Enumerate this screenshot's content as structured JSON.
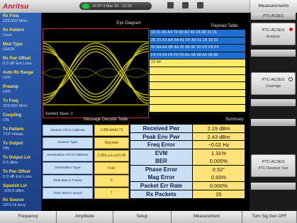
{
  "header": {
    "brand": "Anritsu",
    "status_text": "16:57 4 Mar 15 · 12:23",
    "measurements_tab": "Measurements"
  },
  "left_panel": [
    {
      "label": "Rx Freq",
      "value": "229.650 MHz"
    },
    {
      "label": "Rx Pattern",
      "value": "Cont"
    },
    {
      "label": "Mod Type",
      "value": "GMSK"
    },
    {
      "label": "Rx Pwr Offset",
      "value": "0.0 dB Ext Loss"
    },
    {
      "label": "Auto Rx Range",
      "value": "OFF"
    },
    {
      "label": "Preamp",
      "value": "OFF"
    },
    {
      "label": "Tx Freq",
      "value": "229.650 MHz"
    },
    {
      "label": "Coupling",
      "value": "ON"
    },
    {
      "label": "Tx Pattern",
      "value": "TCP Hdata"
    },
    {
      "label": "Tx Output",
      "value": "ON"
    },
    {
      "label": "Tx Output Lvl",
      "value": "0.5 dBm"
    },
    {
      "label": "Tx Pwr Offset",
      "value": "0.0 dB Ext Loss"
    },
    {
      "label": "Squelch Lvl",
      "value": "-100.0 dBm"
    },
    {
      "label": "Rx Source",
      "value": "GPS Hi Acry"
    }
  ],
  "eye_diagram": {
    "title": "Eye Diagram",
    "footer": "Symbol Span: 2"
  },
  "payload_table": {
    "title": "Payload Table",
    "rows": [
      {
        "style": "blue",
        "text": "18 01 A6 A4 73 80 A2 40 2A 08 31 01"
      },
      {
        "style": "blue",
        "text": "2E 21 A1 AA 5A A1 FF A0 01 16 32 01"
      },
      {
        "style": "blue",
        "text": "05 AA A4 0B 4A 05 00 0F 20 FD F8 FF"
      },
      {
        "style": "blue",
        "text": "F9 F0 F0 F0 F0 F0 A1 0A 08 A5 08 80"
      },
      {
        "style": "yellow",
        "text": "23 48"
      },
      {
        "style": "yellow",
        "text": ""
      },
      {
        "style": "yellow",
        "text": ""
      },
      {
        "style": "yellow",
        "text": ""
      },
      {
        "style": "yellow",
        "text": ""
      },
      {
        "style": "yellow",
        "text": ""
      },
      {
        "style": "yellow",
        "text": ""
      }
    ]
  },
  "message_decode": {
    "title": "Message Decode Table",
    "rows": [
      {
        "label": "Source ATCS Address",
        "value": "1-BB.dddd.73"
      },
      {
        "label": "Source Type",
        "value": "Wayside"
      },
      {
        "label": "Destination ATCS Address",
        "value": "2.999.a.b.cd.ff.48"
      },
      {
        "label": "Destination Type",
        "value": "Train"
      },
      {
        "label": "Total Bad in Frame",
        "value": "0"
      },
      {
        "label": "Time Stat in epoch",
        "value": "7"
      }
    ]
  },
  "summary": {
    "title": "Summary",
    "rows": [
      {
        "label": "Received Pwr",
        "value": "2.19 dBm"
      },
      {
        "label": "Peak Env Pwr",
        "value": "2.43 dBm"
      },
      {
        "label": "Freq Error",
        "value": "−0.02 Hz"
      },
      {
        "label": "EVM",
        "value": "1.31%"
      },
      {
        "label": "BER",
        "value": "0.000%"
      },
      {
        "label": "Phase Error",
        "value": "0.52°"
      },
      {
        "label": "Mag Error",
        "value": "0.93%"
      },
      {
        "label": "Packet Err Rate",
        "value": "0.000%"
      },
      {
        "label": "Rx Packets",
        "value": "25"
      }
    ]
  },
  "right_panel": {
    "btn1": {
      "title": "PTC-ACSES",
      "sub": "Analyzer"
    },
    "btn2": {
      "title": "PTC-ACSES",
      "sub": "Coverage"
    },
    "btn3": {
      "title": "PTC-ACSES",
      "sub": "PTC Receiver Test"
    },
    "top_label": "PTC-ACSES"
  },
  "bottom_bar": [
    "Frequency",
    "Amplitude",
    "Setup",
    "Measurement",
    "Turn Sig Gen OFF"
  ]
}
